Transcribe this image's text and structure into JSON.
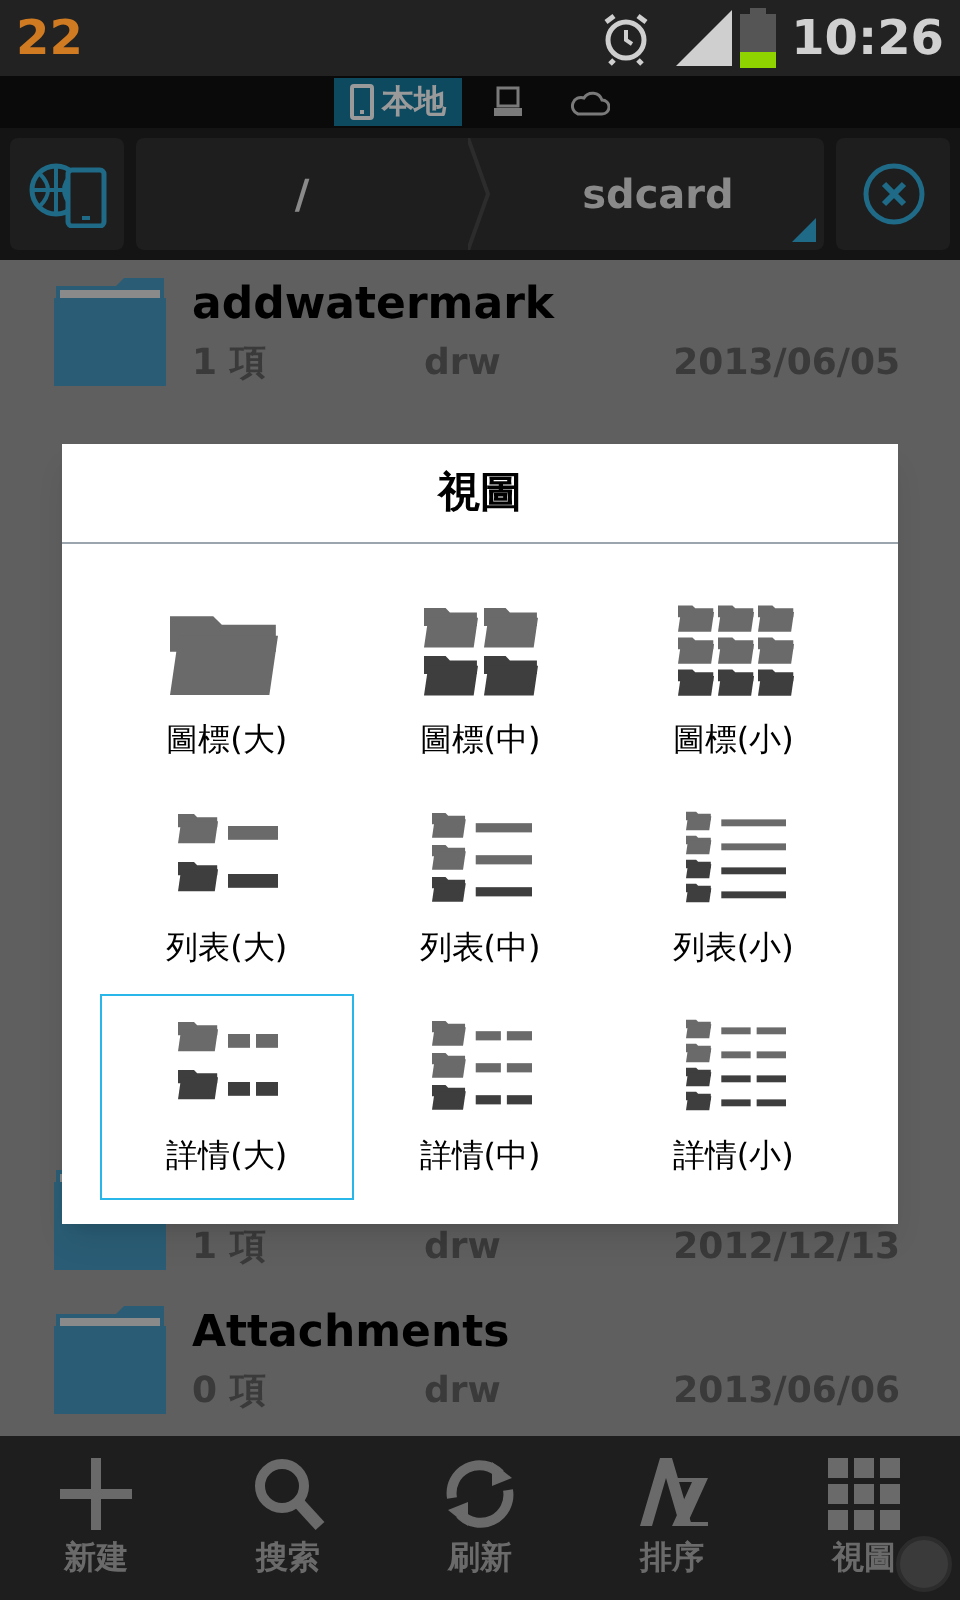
{
  "status_bar": {
    "notification": "22",
    "time": "10:26"
  },
  "location_tabs": [
    {
      "kind": "local",
      "label": "本地",
      "selected": true
    },
    {
      "kind": "network",
      "selected": false
    },
    {
      "kind": "cloud",
      "selected": false
    }
  ],
  "breadcrumb": [
    "/",
    "sdcard"
  ],
  "files": [
    {
      "name": "addwatermark",
      "count": "1 項",
      "permissions": "drw",
      "date": "2013/06/05"
    },
    {
      "count": "1 項",
      "permissions": "drw",
      "date": "2012/12/13"
    },
    {
      "name": "Attachments",
      "count": "0 項",
      "permissions": "drw",
      "date": "2013/06/06"
    }
  ],
  "dialog": {
    "title": "視圖",
    "options": [
      {
        "label": "圖標(大)",
        "kind": "icons",
        "selected": false
      },
      {
        "label": "圖標(中)",
        "kind": "icons",
        "selected": false
      },
      {
        "label": "圖標(小)",
        "kind": "icons",
        "selected": false
      },
      {
        "label": "列表(大)",
        "kind": "list",
        "selected": false
      },
      {
        "label": "列表(中)",
        "kind": "list",
        "selected": false
      },
      {
        "label": "列表(小)",
        "kind": "list",
        "selected": false
      },
      {
        "label": "詳情(大)",
        "kind": "details",
        "selected": true
      },
      {
        "label": "詳情(中)",
        "kind": "details",
        "selected": false
      },
      {
        "label": "詳情(小)",
        "kind": "details",
        "selected": false
      }
    ]
  },
  "bottom_bar": [
    {
      "kind": "new",
      "label": "新建"
    },
    {
      "kind": "search",
      "label": "搜索"
    },
    {
      "kind": "refresh",
      "label": "刷新"
    },
    {
      "kind": "sort",
      "label": "排序"
    },
    {
      "kind": "view",
      "label": "視圖"
    }
  ]
}
